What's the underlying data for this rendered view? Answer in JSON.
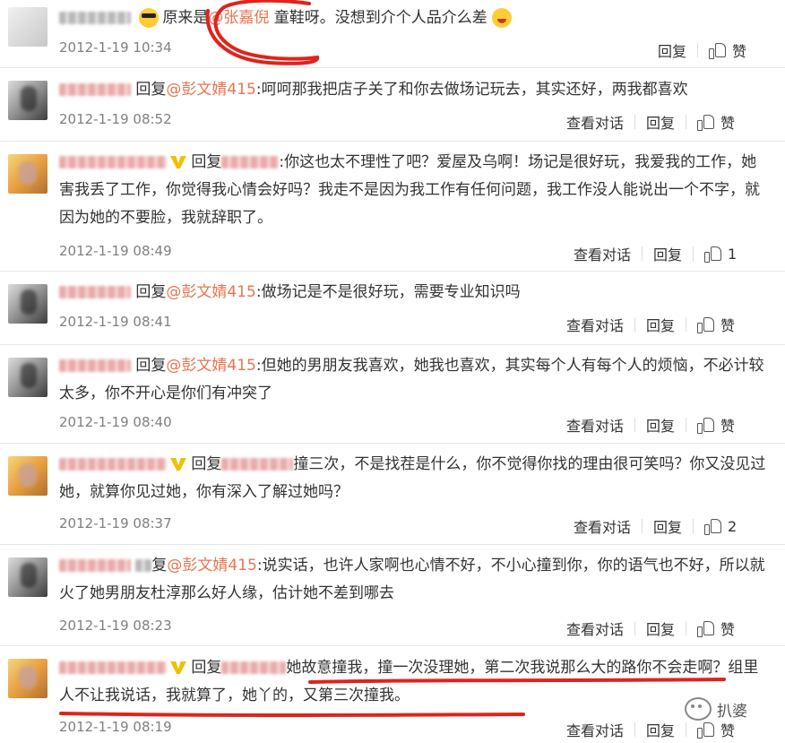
{
  "comments": [
    {
      "text_a": "原来是",
      "mention": "@张嘉倪",
      "text_b": " 童鞋呀。没想到介个人品介么差",
      "time": "2012-1-19 10:34",
      "reply": "回复",
      "like": "赞"
    },
    {
      "prefix": "回复",
      "mention": "@彭文婧415",
      "text": ":呵呵那我把店子关了和你去做场记玩去，其实还好，两我都喜欢",
      "time": "2012-1-19 08:52",
      "view": "查看对话",
      "reply": "回复",
      "like": "赞"
    },
    {
      "prefix": "回复",
      "text_line1": ":你这也太不理性了吧？爱屋及乌啊！场记是很好玩，我爱我的",
      "text_rest": "工作，她害我丢了工作，你觉得我心情会好吗？我走不是因为我工作有任何问题，我工作没人能说出一个不字，就因为她的不要脸，我就辞职了。",
      "time": "2012-1-19 08:49",
      "view": "查看对话",
      "reply": "回复",
      "like": "1"
    },
    {
      "prefix": "回复",
      "mention": "@彭文婧415",
      "text": ":做场记是不是很好玩，需要专业知识吗",
      "time": "2012-1-19 08:41",
      "view": "查看对话",
      "reply": "回复",
      "like": "赞"
    },
    {
      "prefix": "回复",
      "mention": "@彭文婧415",
      "text_line1": ":但她的男朋友我喜欢，她我也喜欢，其实每个人有每个人的烦恼，不",
      "text_rest": "必计较太多，你不开心是你们有冲突了",
      "time": "2012-1-19 08:40",
      "view": "查看对话",
      "reply": "回复",
      "like": "赞"
    },
    {
      "prefix": "回复",
      "text_line1": "撞三次，不是找茬是什么，你不觉得你找的理由很可笑吗？你",
      "text_rest": "又没见过她，就算你见过她，你有深入了解过她吗？",
      "time": "2012-1-19 08:37",
      "view": "查看对话",
      "reply": "回复",
      "like": "2"
    },
    {
      "prefix": "复",
      "mention": "@彭文婧415",
      "text_line1": ":说实话，也许人家啊也心情不好，不小心撞到你，你的语气也不好，",
      "text_rest": "所以就火了她男朋友杜淳那么好人缘，估计她不差到哪去",
      "time": "2012-1-19 08:23",
      "view": "查看对话",
      "reply": "回复",
      "like": "赞"
    },
    {
      "prefix": "回复",
      "text_line1": "她故意撞我，撞一次没理她，第二次我说那么大的路你不会走",
      "text_rest": "啊？组里人不让我说话，我就算了，她丫的，又第三次撞我。",
      "time": "2012-1-19 08:19",
      "view": "查看对话",
      "reply": "回复",
      "like": "赞"
    }
  ],
  "watermark": {
    "label": "扒婆"
  },
  "colors": {
    "mention": "#eb7350",
    "annotation": "#e0231b",
    "meta": "#808080"
  }
}
